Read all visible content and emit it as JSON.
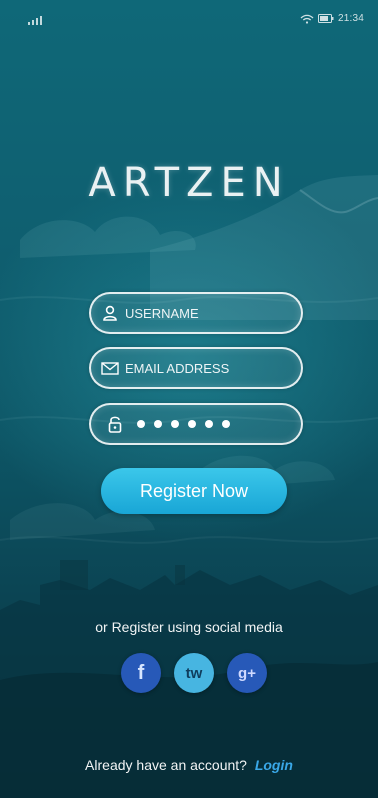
{
  "status_bar": {
    "time": "21:34",
    "icons": [
      "signal-icon",
      "wifi-icon",
      "battery-icon"
    ]
  },
  "app": {
    "logo": "ARTZEN"
  },
  "form": {
    "username": {
      "placeholder": "USERNAME",
      "icon": "user-icon"
    },
    "email": {
      "placeholder": "EMAIL ADDRESS",
      "icon": "envelope-icon"
    },
    "password": {
      "masked_length": 6,
      "icon": "lock-icon"
    },
    "register_label": "Register Now"
  },
  "social": {
    "caption": "or Register using social media",
    "buttons": [
      {
        "label": "f",
        "icon": "facebook-icon",
        "color": "#2759b8"
      },
      {
        "label": "tw",
        "icon": "twitter-icon",
        "color": "#47b5e1"
      },
      {
        "label": "g+",
        "icon": "google-plus-icon",
        "color": "#2759b8"
      }
    ]
  },
  "footer": {
    "prompt": "Already have an account?",
    "login_label": "Login"
  },
  "colors": {
    "accent": "#19a6d6",
    "link": "#3aa8e8",
    "background": "#0f5f70"
  }
}
